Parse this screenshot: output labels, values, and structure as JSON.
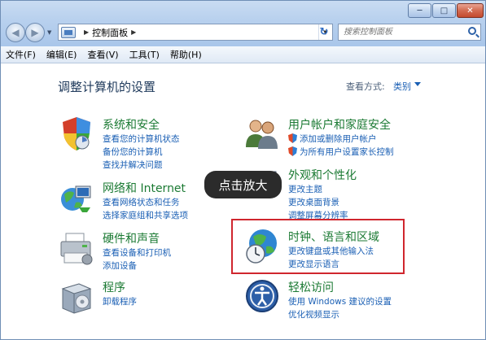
{
  "window": {
    "controls": {
      "minimize": "─",
      "maximize": "□",
      "close": "✕"
    }
  },
  "nav": {
    "back_glyph": "◀",
    "forward_glyph": "▶",
    "dropdown_glyph": "▼",
    "refresh_glyph": "↻"
  },
  "address": {
    "separator": "▶",
    "path_label": "控制面板",
    "trailing_separator": "▶",
    "dropdown_glyph": "▼"
  },
  "search": {
    "placeholder": "搜索控制面板"
  },
  "menu": [
    "文件(F)",
    "编辑(E)",
    "查看(V)",
    "工具(T)",
    "帮助(H)"
  ],
  "main": {
    "heading": "调整计算机的设置",
    "view_by_label": "查看方式:",
    "view_by_value": "类别"
  },
  "categories": {
    "system_security": {
      "title": "系统和安全",
      "links": [
        "查看您的计算机状态",
        "备份您的计算机",
        "查找并解决问题"
      ]
    },
    "network": {
      "title": "网络和 Internet",
      "links": [
        "查看网络状态和任务",
        "选择家庭组和共享选项"
      ]
    },
    "hardware": {
      "title": "硬件和声音",
      "links": [
        "查看设备和打印机",
        "添加设备"
      ]
    },
    "programs": {
      "title": "程序",
      "links": [
        "卸载程序"
      ]
    },
    "user_accounts": {
      "title": "用户帐户和家庭安全",
      "links": [
        "添加或删除用户帐户",
        "为所有用户设置家长控制"
      ]
    },
    "appearance": {
      "title": "外观和个性化",
      "links": [
        "更改主题",
        "更改桌面背景",
        "调整屏幕分辨率"
      ]
    },
    "clock_region": {
      "title": "时钟、语言和区域",
      "links": [
        "更改键盘或其他输入法",
        "更改显示语言"
      ]
    },
    "ease_of_access": {
      "title": "轻松访问",
      "links": [
        "使用 Windows 建议的设置",
        "优化视频显示"
      ]
    }
  },
  "overlay": {
    "tooltip": "点击放大"
  },
  "colors": {
    "category_title": "#1b7a33",
    "link": "#1a5fb4",
    "highlight": "#d0262e"
  }
}
